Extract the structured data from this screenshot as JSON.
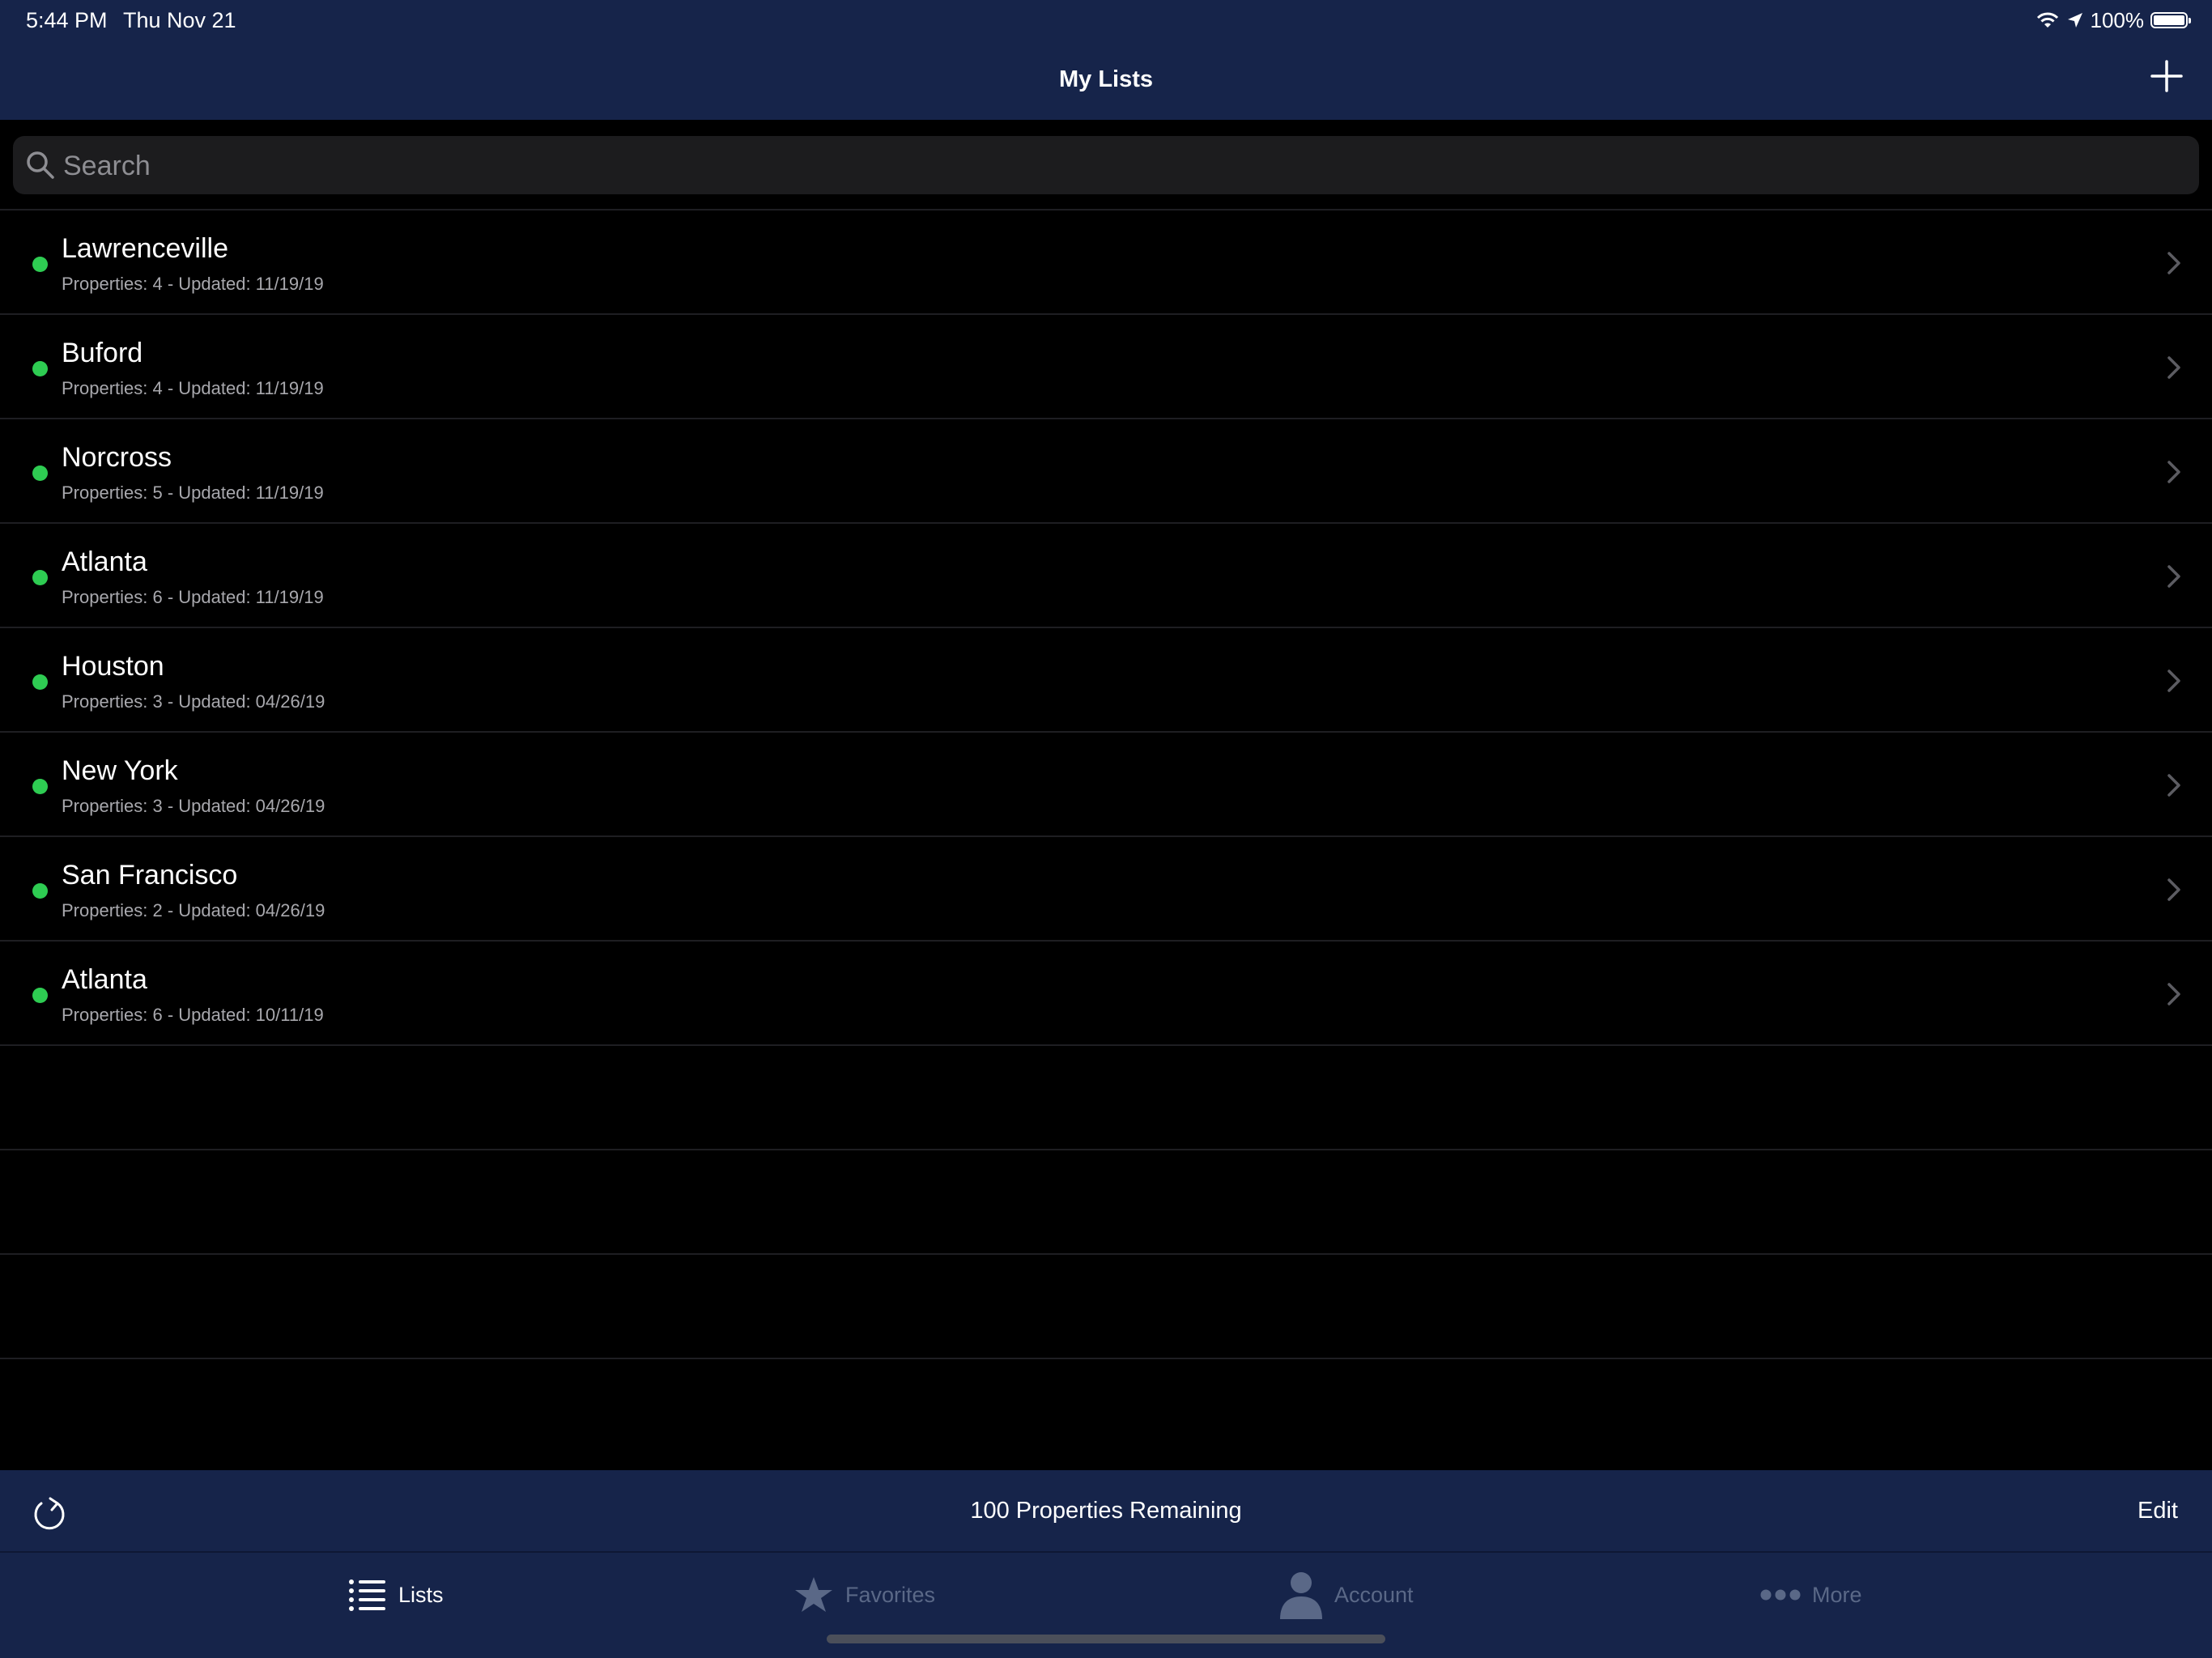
{
  "status_bar": {
    "time": "5:44 PM",
    "date": "Thu Nov 21",
    "battery": "100%"
  },
  "nav": {
    "title": "My Lists"
  },
  "search": {
    "placeholder": "Search",
    "value": ""
  },
  "lists": [
    {
      "name": "Lawrenceville",
      "meta": "Properties: 4 - Updated: 11/19/19"
    },
    {
      "name": "Buford",
      "meta": "Properties: 4 - Updated: 11/19/19"
    },
    {
      "name": "Norcross",
      "meta": "Properties: 5 - Updated: 11/19/19"
    },
    {
      "name": "Atlanta",
      "meta": "Properties: 6 - Updated: 11/19/19"
    },
    {
      "name": "Houston",
      "meta": "Properties: 3 - Updated: 04/26/19"
    },
    {
      "name": "New York",
      "meta": "Properties: 3 - Updated: 04/26/19"
    },
    {
      "name": "San Francisco",
      "meta": "Properties: 2 - Updated: 04/26/19"
    },
    {
      "name": "Atlanta",
      "meta": "Properties: 6 - Updated: 10/11/19"
    }
  ],
  "toolbar": {
    "remaining": "100 Properties Remaining",
    "edit_label": "Edit"
  },
  "tabs": [
    {
      "label": "Lists",
      "icon": "list-icon",
      "active": true
    },
    {
      "label": "Favorites",
      "icon": "star-icon",
      "active": false
    },
    {
      "label": "Account",
      "icon": "person-icon",
      "active": false
    },
    {
      "label": "More",
      "icon": "ellipsis-icon",
      "active": false
    }
  ],
  "colors": {
    "nav_background": "#16244a",
    "status_dot": "#2ecc52",
    "inactive_tab": "#5a6887"
  }
}
